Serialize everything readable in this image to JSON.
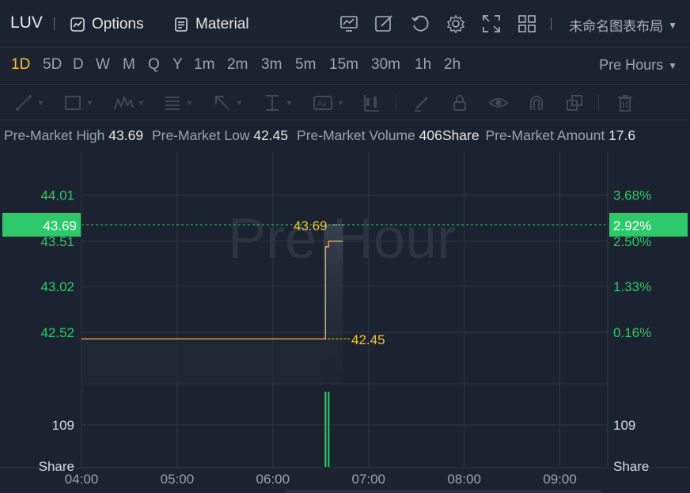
{
  "header": {
    "ticker": "LUV",
    "options_label": "Options",
    "material_label": "Material",
    "layout_name": "未命名图表布局"
  },
  "intervals": {
    "items": [
      "1D",
      "5D",
      "D",
      "W",
      "M",
      "Q",
      "Y",
      "1m",
      "2m",
      "3m",
      "5m",
      "15m",
      "30m",
      "1h",
      "2h"
    ],
    "active": "1D",
    "session_label": "Pre Hours"
  },
  "info": {
    "high_label": "Pre-Market High",
    "high_value": "43.69",
    "low_label": "Pre-Market Low",
    "low_value": "42.45",
    "volume_label": "Pre-Market Volume",
    "volume_value": "406Share",
    "amount_label": "Pre-Market Amount",
    "amount_value": "17.6"
  },
  "chart": {
    "watermark": "Pre Hour",
    "y_left_ticks": [
      "44.01",
      "43.51",
      "43.02",
      "42.52"
    ],
    "y_right_ticks": [
      "3.68%",
      "2.50%",
      "1.33%",
      "0.16%"
    ],
    "current_price": "43.69",
    "current_pct": "2.92%",
    "high_label": "43.69",
    "low_label": "42.45",
    "volume_tick_left": "109",
    "volume_tick_right": "109",
    "volume_unit_left": "Share",
    "volume_unit_right": "Share",
    "x_ticks": [
      "04:00",
      "05:00",
      "06:00",
      "07:00",
      "08:00",
      "09:00"
    ],
    "colors": {
      "line": "#f0a04b",
      "up": "#2ec96b",
      "price_tag": "#2ec96b",
      "label": "#f4c724"
    }
  },
  "chart_data": {
    "type": "line",
    "title": "",
    "xlabel": "",
    "ylabel": "",
    "x_range": [
      "04:00",
      "09:30"
    ],
    "ylim": [
      42.0,
      44.3
    ],
    "grid": true,
    "series": [
      {
        "x": [
          "04:00",
          "06:32",
          "06:33",
          "06:34",
          "06:35",
          "06:44"
        ],
        "values": [
          42.45,
          42.45,
          43.45,
          43.45,
          43.51,
          43.51
        ]
      }
    ],
    "volume": {
      "x": [
        "06:33",
        "06:35"
      ],
      "values": [
        100,
        100
      ]
    },
    "reference_lines": {
      "current": 43.69,
      "high": 43.69,
      "low": 42.45
    }
  }
}
